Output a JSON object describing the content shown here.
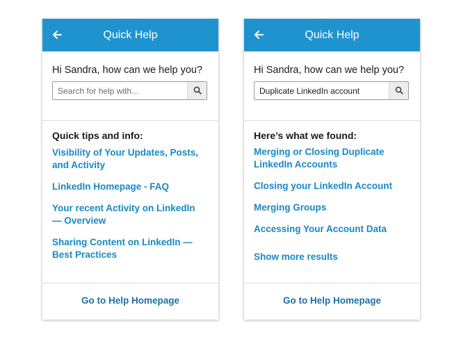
{
  "left_panel": {
    "header": {
      "title": "Quick Help"
    },
    "greeting": "Hi Sandra, how can we help you?",
    "search": {
      "value": "",
      "placeholder": "Search for help with..."
    },
    "section_heading": "Quick tips and info:",
    "links": [
      "Visibility of Your Updates, Posts, and Activity",
      "LinkedIn Homepage - FAQ",
      "Your recent Activity on LinkedIn — Overview",
      "Sharing Content on LinkedIn — Best Practices"
    ],
    "footer_link": "Go to Help Homepage"
  },
  "right_panel": {
    "header": {
      "title": "Quick Help"
    },
    "greeting": "Hi Sandra, how can we help you?",
    "search": {
      "value": "Duplicate LinkedIn account",
      "placeholder": ""
    },
    "section_heading": "Here’s what we found:",
    "links": [
      "Merging or Closing Duplicate LinkedIn Accounts",
      "Closing your LinkedIn Account",
      "Merging Groups",
      "Accessing Your Account Data"
    ],
    "show_more": "Show more results",
    "footer_link": "Go to Help Homepage"
  },
  "colors": {
    "header_blue": "#1f93cf",
    "link_blue": "#1888c4",
    "footer_blue": "#1d6fa5"
  },
  "icons": {
    "back": "arrow-left-icon",
    "search": "search-icon"
  }
}
